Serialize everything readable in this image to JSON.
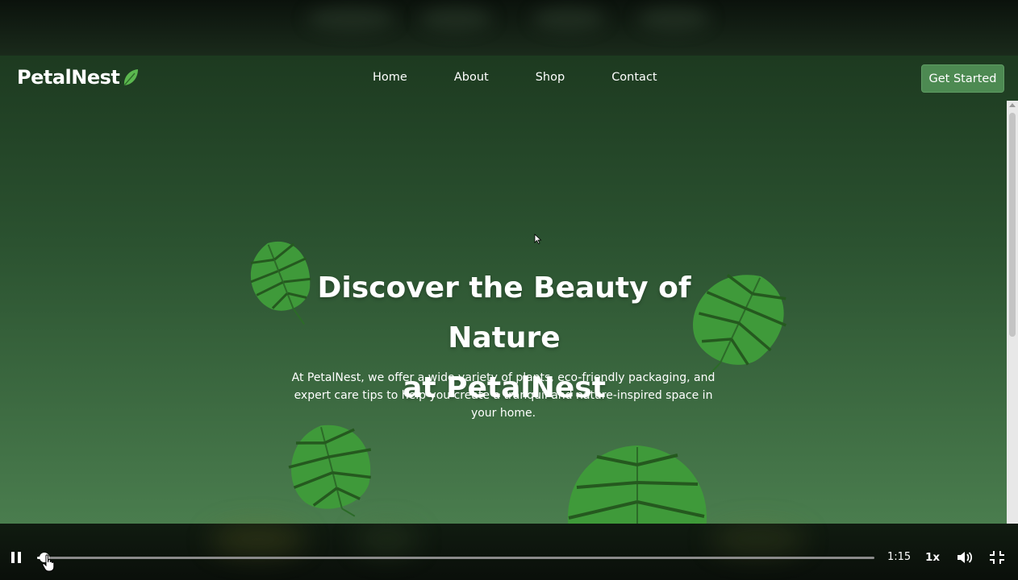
{
  "site": {
    "logo_text": "PetalNest",
    "nav": [
      {
        "label": "Home"
      },
      {
        "label": "About"
      },
      {
        "label": "Shop"
      },
      {
        "label": "Contact"
      }
    ],
    "cta_label": "Get Started",
    "hero_title_line1": "Discover the Beauty of Nature",
    "hero_title_line2": "at PetalNest",
    "hero_description": "At PetalNest, we offer a wide variety of plants, eco-friendly packaging, and expert care tips to help you create a tranquil and nature-inspired space in your home."
  },
  "player": {
    "time_label": "1:15",
    "speed_label": "1x",
    "progress_fraction": 0.009,
    "icons": [
      "pause-icon",
      "volume-icon",
      "exit-fullscreen-icon"
    ]
  },
  "colors": {
    "accent": "#4d8a52",
    "hero_top": "#1d3a20",
    "hero_bottom": "#4a7d4e",
    "leaf": "#3f9a3a"
  }
}
